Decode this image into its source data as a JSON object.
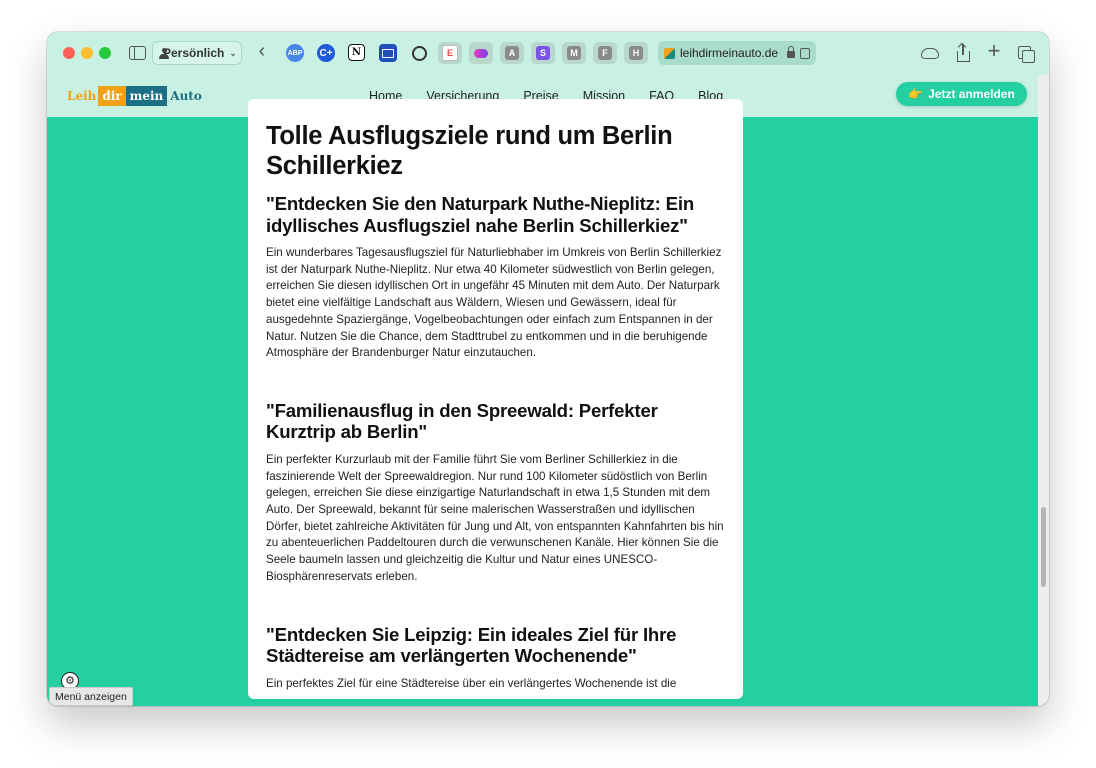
{
  "browser": {
    "profile_label": "Persönlich",
    "address_url": "leihdirmeinauto.de",
    "extensions": [
      {
        "name": "adblock-plus-icon",
        "label": "ABP"
      },
      {
        "name": "c-extension-icon",
        "label": "C+"
      },
      {
        "name": "notion-icon",
        "label": "N"
      },
      {
        "name": "book-extension-icon",
        "label": ""
      },
      {
        "name": "record-icon",
        "label": ""
      },
      {
        "name": "tab-icon-1",
        "label": "E"
      },
      {
        "name": "tab-icon-2",
        "label": ""
      },
      {
        "name": "tab-icon-a",
        "label": "A"
      },
      {
        "name": "tab-icon-s",
        "label": "S"
      },
      {
        "name": "tab-icon-m",
        "label": "M"
      },
      {
        "name": "tab-icon-f",
        "label": "F"
      },
      {
        "name": "tab-icon-h",
        "label": "H"
      }
    ]
  },
  "site": {
    "logo": {
      "w1": "Leih",
      "w2": "dir",
      "w3": "mein",
      "w4": "Auto"
    },
    "nav": [
      "Home",
      "Versicherung",
      "Preise",
      "Mission",
      "FAQ",
      "Blog"
    ],
    "signin_hand": "👉",
    "signin_label": "Jetzt anmelden"
  },
  "article": {
    "title": "Tolle Ausflugsziele rund um Berlin Schillerkiez",
    "sections": [
      {
        "heading": "\"Entdecken Sie den Naturpark Nuthe-Nieplitz: Ein idyllisches Ausflugsziel nahe Berlin Schillerkiez\"",
        "text": "Ein wunderbares Tagesausflugsziel für Naturliebhaber im Umkreis von Berlin Schillerkiez ist der Naturpark Nuthe-Nieplitz. Nur etwa 40 Kilometer südwestlich von Berlin gelegen, erreichen Sie diesen idyllischen Ort in ungefähr 45 Minuten mit dem Auto. Der Naturpark bietet eine vielfältige Landschaft aus Wäldern, Wiesen und Gewässern, ideal für ausgedehnte Spaziergänge, Vogelbeobachtungen oder einfach zum Entspannen in der Natur. Nutzen Sie die Chance, dem Stadttrubel zu entkommen und in die beruhigende Atmosphäre der Brandenburger Natur einzutauchen."
      },
      {
        "heading": "\"Familienausflug in den Spreewald: Perfekter Kurztrip ab Berlin\"",
        "text": "Ein perfekter Kurzurlaub mit der Familie führt Sie vom Berliner Schillerkiez in die faszinierende Welt der Spreewaldregion. Nur rund 100 Kilometer südöstlich von Berlin gelegen, erreichen Sie diese einzigartige Naturlandschaft in etwa 1,5 Stunden mit dem Auto. Der Spreewald, bekannt für seine malerischen Wasserstraßen und idyllischen Dörfer, bietet zahlreiche Aktivitäten für Jung und Alt, von entspannten Kahnfahrten bis hin zu abenteuerlichen Paddeltouren durch die verwunschenen Kanäle. Hier können Sie die Seele baumeln lassen und gleichzeitig die Kultur und Natur eines UNESCO-Biosphärenreservats erleben."
      },
      {
        "heading": "\"Entdecken Sie Leipzig: Ein ideales Ziel für Ihre Städtereise am verlängerten Wochenende\"",
        "text": "Ein perfektes Ziel für eine Städtereise über ein verlängertes Wochenende ist die"
      }
    ]
  },
  "overlay": {
    "menu_tooltip": "Menü anzeigen",
    "gear_glyph": "⚙"
  }
}
